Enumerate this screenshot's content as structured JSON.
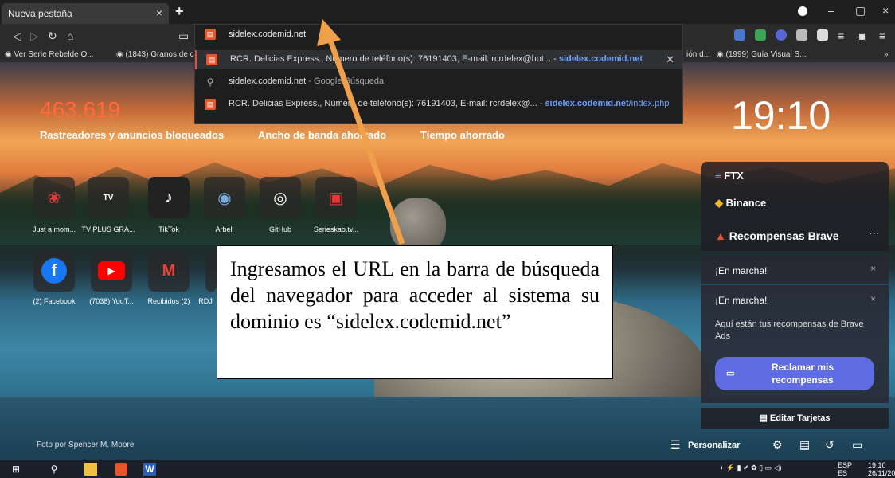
{
  "tab": {
    "title": "Nueva pestaña",
    "close": "×",
    "new_tab": "+"
  },
  "window": {
    "minimize": "–",
    "maximize": "▢",
    "close": "×"
  },
  "address": {
    "value": "sidelex.codemid.net"
  },
  "bookmarks": [
    "Ver Serie Rebelde O...",
    "(1843) Granos de c",
    "ión d...",
    "(1999) Guía Visual S...",
    "»"
  ],
  "omnibox": {
    "rows": [
      {
        "title": "RCR. Delicias Express., Número de teléfono(s): 76191403, E-mail: rcrdelex@hot...",
        "sep": " - ",
        "url": "sidelex.codemid.net",
        "url_rest": ""
      },
      {
        "title": "sidelex.codemid.net",
        "sep": " - ",
        "url": "",
        "url_rest": "Google Búsqueda"
      },
      {
        "title": "RCR. Delicias Express., Número de teléfono(s): 76191403, E-mail: rcrdelex@...",
        "sep": " - ",
        "url": "sidelex.codemid.net",
        "url_rest": "/index.php"
      }
    ]
  },
  "stats": {
    "trackers_count": "463.619",
    "trackers_label": "Rastreadores y anuncios bloqueados",
    "bandwidth_label": "Ancho de banda ahorrado",
    "time_label": "Tiempo ahorrado"
  },
  "clock": "19:10",
  "tiles_row1": [
    "Just a mom...",
    "TV PLUS GRA...",
    "TikTok",
    "Arbell",
    "GitHub",
    "Serieskao.tv..."
  ],
  "tiles_row2": [
    "(2) Facebook",
    "(7038) YouT...",
    "Recibidos (2)",
    "RDJ"
  ],
  "widgets": {
    "ftx": "FTX",
    "binance": "Binance",
    "rewards_title": "Recompensas Brave",
    "rewards_more": "···",
    "notice1": "¡En marcha!",
    "notice2": "¡En marcha!",
    "notice_close": "×",
    "notice_body": "Aquí están tus recompensas de Brave Ads",
    "claim_button": "Reclamar mis recompensas",
    "edit_cards": "Editar Tarjetas"
  },
  "note": {
    "text": "Ingresamos el URL en la barra de búsqueda del navegador para acceder al sistema su dominio es “sidelex.codemid.net”"
  },
  "photo_credit": "Foto por Spencer M. Moore",
  "customize": "Personalizar",
  "tray": {
    "lang1": "ESP",
    "lang2": "ES",
    "time": "19:10",
    "date": "26/11/20"
  }
}
